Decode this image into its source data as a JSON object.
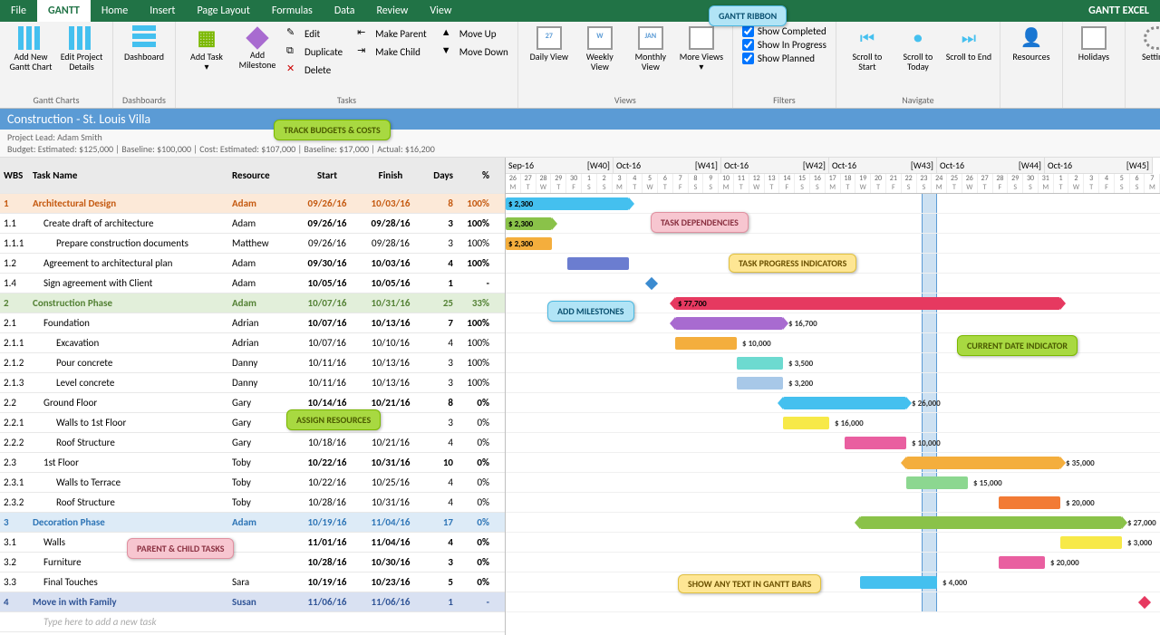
{
  "menu": {
    "tabs": [
      "File",
      "GANTT",
      "Home",
      "Insert",
      "Page Layout",
      "Formulas",
      "Data",
      "Review",
      "View"
    ],
    "active": 1,
    "brand": "GANTT EXCEL"
  },
  "ribbon": {
    "groups": {
      "ganttCharts": {
        "label": "Gantt Charts",
        "addNew": "Add New Gantt Chart",
        "edit": "Edit Project Details"
      },
      "dashboards": {
        "label": "Dashboards",
        "dashboard": "Dashboard"
      },
      "tasks": {
        "label": "Tasks",
        "add": "Add Task",
        "milestone": "Add Milestone",
        "edit": "Edit",
        "dup": "Duplicate",
        "del": "Delete",
        "mp": "Make Parent",
        "mc": "Make Child",
        "mu": "Move Up",
        "md": "Move Down"
      },
      "views": {
        "label": "Views",
        "daily": "Daily View",
        "weekly": "Weekly View",
        "monthly": "Monthly View",
        "more": "More Views"
      },
      "filters": {
        "label": "Filters",
        "completed": "Show Completed",
        "inprogress": "Show In Progress",
        "planned": "Show Planned"
      },
      "navigate": {
        "label": "Navigate",
        "start": "Scroll to Start",
        "today": "Scroll to Today",
        "end": "Scroll to End"
      },
      "resources": {
        "label": "Resources"
      },
      "holidays": {
        "label": "Holidays"
      },
      "settings": {
        "label": "Settings"
      }
    }
  },
  "project": {
    "title": "Construction - St. Louis Villa",
    "lead": "Project Lead: Adam Smith",
    "budget": "Budget: Estimated: $125,000 | Baseline: $100,000 | Cost: Estimated: $107,000 | Baseline: $17,000 | Actual: $16,200"
  },
  "columns": {
    "wbs": "WBS",
    "name": "Task Name",
    "res": "Resource",
    "start": "Start",
    "finish": "Finish",
    "days": "Days",
    "pct": "%"
  },
  "tasks": [
    {
      "wbs": "1",
      "name": "Architectural Design",
      "res": "Adam",
      "start": "09/26/16",
      "finish": "10/03/16",
      "days": "8",
      "pct": "100%",
      "lvl": 0,
      "cls": "orange",
      "bar": {
        "s": 0,
        "w": 8,
        "color": "#44c0ef",
        "lbl": "$ 2,300",
        "arrows": true
      }
    },
    {
      "wbs": "1.1",
      "name": "Create draft of architecture",
      "res": "Adam",
      "start": "09/26/16",
      "finish": "09/28/16",
      "days": "3",
      "pct": "100%",
      "lvl": 1,
      "bar": {
        "s": 0,
        "w": 3,
        "color": "#8ac249",
        "lbl": "$ 2,300",
        "arrows": true
      }
    },
    {
      "wbs": "1.1.1",
      "name": "Prepare construction documents",
      "res": "Matthew",
      "start": "09/26/16",
      "finish": "09/28/16",
      "days": "3",
      "pct": "100%",
      "lvl": 2,
      "bar": {
        "s": 0,
        "w": 3,
        "color": "#f4ae3d",
        "lbl": "$ 2,300"
      }
    },
    {
      "wbs": "1.2",
      "name": "Agreement to architectural plan",
      "res": "Adam",
      "start": "09/30/16",
      "finish": "10/03/16",
      "days": "4",
      "pct": "100%",
      "lvl": 1,
      "bar": {
        "s": 4,
        "w": 4,
        "color": "#6b7dd0"
      }
    },
    {
      "wbs": "1.4",
      "name": "Sign agreement with Client",
      "res": "Adam",
      "start": "10/05/16",
      "finish": "10/05/16",
      "days": "1",
      "pct": "-",
      "lvl": 1,
      "diamond": {
        "s": 9,
        "color": "#3b8bd0"
      }
    },
    {
      "wbs": "2",
      "name": "Construction Phase",
      "res": "Adam",
      "start": "10/07/16",
      "finish": "10/31/16",
      "days": "25",
      "pct": "33%",
      "lvl": 0,
      "cls": "green",
      "bar": {
        "s": 11,
        "w": 25,
        "color": "#e63960",
        "lbl": "$ 77,700",
        "arrows": true,
        "out": false
      }
    },
    {
      "wbs": "2.1",
      "name": "Foundation",
      "res": "Adrian",
      "start": "10/07/16",
      "finish": "10/13/16",
      "days": "7",
      "pct": "100%",
      "lvl": 1,
      "bar": {
        "s": 11,
        "w": 7,
        "color": "#a86bd0",
        "lbl": "$ 16,700",
        "arrows": true,
        "out": true
      }
    },
    {
      "wbs": "2.1.1",
      "name": "Excavation",
      "res": "Adrian",
      "start": "10/07/16",
      "finish": "10/10/16",
      "days": "4",
      "pct": "100%",
      "lvl": 2,
      "bar": {
        "s": 11,
        "w": 4,
        "color": "#f4ae3d",
        "lbl": "$ 10,000",
        "out": true
      }
    },
    {
      "wbs": "2.1.2",
      "name": "Pour concrete",
      "res": "Danny",
      "start": "10/11/16",
      "finish": "10/13/16",
      "days": "3",
      "pct": "100%",
      "lvl": 2,
      "bar": {
        "s": 15,
        "w": 3,
        "color": "#6ddad0",
        "lbl": "$ 3,500",
        "out": true
      }
    },
    {
      "wbs": "2.1.3",
      "name": "Level concrete",
      "res": "Danny",
      "start": "10/11/16",
      "finish": "10/13/16",
      "days": "3",
      "pct": "100%",
      "lvl": 2,
      "bar": {
        "s": 15,
        "w": 3,
        "color": "#a8c8e8",
        "lbl": "$ 3,200",
        "out": true
      }
    },
    {
      "wbs": "2.2",
      "name": "Ground Floor",
      "res": "Gary",
      "start": "10/14/16",
      "finish": "10/21/16",
      "days": "8",
      "pct": "0%",
      "lvl": 1,
      "bar": {
        "s": 18,
        "w": 8,
        "color": "#44c0ef",
        "lbl": "$ 26,000",
        "arrows": true,
        "out": true
      }
    },
    {
      "wbs": "2.2.1",
      "name": "Walls to 1st Floor",
      "res": "Gary",
      "start": "",
      "finish": "",
      "days": "3",
      "pct": "0%",
      "lvl": 2,
      "bar": {
        "s": 18,
        "w": 3,
        "color": "#f7e948",
        "lbl": "$ 16,000",
        "out": true
      }
    },
    {
      "wbs": "2.2.2",
      "name": "Roof Structure",
      "res": "Gary",
      "start": "10/18/16",
      "finish": "10/21/16",
      "days": "4",
      "pct": "0%",
      "lvl": 2,
      "bar": {
        "s": 22,
        "w": 4,
        "color": "#e95fa0",
        "lbl": "$ 10,000",
        "out": true
      }
    },
    {
      "wbs": "2.3",
      "name": "1st Floor",
      "res": "Toby",
      "start": "10/22/16",
      "finish": "10/31/16",
      "days": "10",
      "pct": "0%",
      "lvl": 1,
      "bar": {
        "s": 26,
        "w": 10,
        "color": "#f4ae3d",
        "lbl": "$ 35,000",
        "arrows": true,
        "out": true
      }
    },
    {
      "wbs": "2.3.1",
      "name": "Walls to Terrace",
      "res": "Toby",
      "start": "10/22/16",
      "finish": "10/25/16",
      "days": "4",
      "pct": "0%",
      "lvl": 2,
      "bar": {
        "s": 26,
        "w": 4,
        "color": "#8cd790",
        "lbl": "$ 15,000",
        "out": true
      }
    },
    {
      "wbs": "2.3.2",
      "name": "Roof Structure",
      "res": "Toby",
      "start": "10/28/16",
      "finish": "10/31/16",
      "days": "4",
      "pct": "0%",
      "lvl": 2,
      "bar": {
        "s": 32,
        "w": 4,
        "color": "#f27b35",
        "lbl": "$ 20,000",
        "out": true
      }
    },
    {
      "wbs": "3",
      "name": "Decoration Phase",
      "res": "Adam",
      "start": "10/19/16",
      "finish": "11/04/16",
      "days": "17",
      "pct": "0%",
      "lvl": 0,
      "cls": "blue",
      "bar": {
        "s": 23,
        "w": 17,
        "color": "#8ac249",
        "lbl": "$ 27,000",
        "arrows": true,
        "out": true
      }
    },
    {
      "wbs": "3.1",
      "name": "Walls",
      "res": "",
      "start": "11/01/16",
      "finish": "11/04/16",
      "days": "4",
      "pct": "0%",
      "lvl": 1,
      "bar": {
        "s": 36,
        "w": 4,
        "color": "#f7e948",
        "lbl": "$ 3,000",
        "out": true
      }
    },
    {
      "wbs": "3.2",
      "name": "Furniture",
      "res": "",
      "start": "10/28/16",
      "finish": "10/30/16",
      "days": "3",
      "pct": "0%",
      "lvl": 1,
      "bar": {
        "s": 32,
        "w": 3,
        "color": "#e95fa0",
        "lbl": "$ 20,000",
        "out": true
      }
    },
    {
      "wbs": "3.3",
      "name": "Final Touches",
      "res": "Sara",
      "start": "10/19/16",
      "finish": "10/23/16",
      "days": "5",
      "pct": "0%",
      "lvl": 1,
      "bar": {
        "s": 23,
        "w": 5,
        "color": "#44c0ef",
        "lbl": "$ 4,000",
        "out": true
      }
    },
    {
      "wbs": "4",
      "name": "Move in with Family",
      "res": "Susan",
      "start": "11/06/16",
      "finish": "11/06/16",
      "days": "1",
      "pct": "-",
      "lvl": 0,
      "cls": "dark",
      "diamond": {
        "s": 41,
        "color": "#e63960"
      }
    }
  ],
  "newTask": "Type here to add a new task",
  "timeline": {
    "months": [
      {
        "m": "Sep-16",
        "w": "[W40]",
        "days": 7
      },
      {
        "m": "Oct-16",
        "w": "[W41]",
        "days": 7
      },
      {
        "m": "Oct-16",
        "w": "[W42]",
        "days": 7
      },
      {
        "m": "Oct-16",
        "w": "[W43]",
        "days": 7
      },
      {
        "m": "Oct-16",
        "w": "[W44]",
        "days": 7
      },
      {
        "m": "Oct-16",
        "w": "[W45]",
        "days": 7
      }
    ],
    "startDay": 26,
    "daynums": [
      "26",
      "27",
      "28",
      "29",
      "30",
      "1",
      "2",
      "3",
      "4",
      "5",
      "6",
      "7",
      "8",
      "9",
      "10",
      "11",
      "12",
      "13",
      "14",
      "15",
      "16",
      "17",
      "18",
      "19",
      "20",
      "21",
      "22",
      "23",
      "24",
      "25",
      "26",
      "27",
      "28",
      "29",
      "30",
      "31",
      "1",
      "2",
      "3",
      "4",
      "5",
      "6",
      "7"
    ],
    "dows": [
      "M",
      "T",
      "W",
      "T",
      "F",
      "S",
      "S",
      "M",
      "T",
      "W",
      "T",
      "F",
      "S",
      "S",
      "M",
      "T",
      "W",
      "T",
      "F",
      "S",
      "S",
      "M",
      "T",
      "W",
      "T",
      "F",
      "S",
      "S",
      "M",
      "T",
      "W",
      "T",
      "F",
      "S",
      "S",
      "M",
      "T",
      "W",
      "T",
      "F",
      "S",
      "S",
      "M"
    ],
    "todayIndex": 27
  },
  "callouts": {
    "ganttRibbon": "GANTT RIBBON",
    "trackBudgets": "TRACK BUDGETS & COSTS",
    "taskDeps": "TASK DEPENDENCIES",
    "taskProgress": "TASK PROGRESS INDICATORS",
    "addMilestones": "ADD MILESTONES",
    "currentDate": "CURRENT DATE INDICATOR",
    "assignRes": "ASSIGN RESOURCES",
    "parentChild": "PARENT & CHILD TASKS",
    "showText": "SHOW ANY TEXT IN GANTT BARS"
  }
}
